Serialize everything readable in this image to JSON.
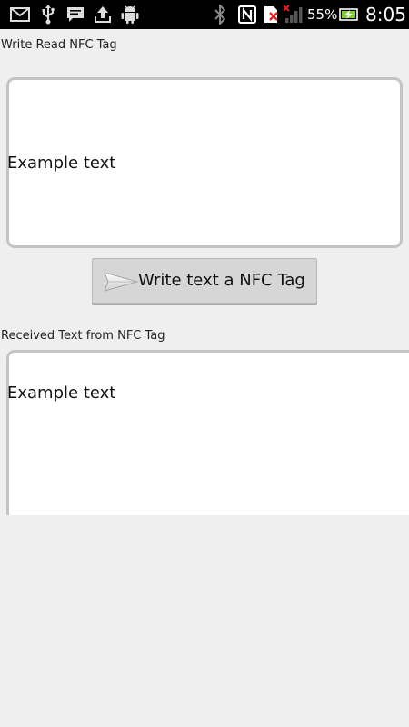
{
  "status_bar": {
    "icons_left": [
      "gmail-icon",
      "usb-icon",
      "sms-icon",
      "upload-icon",
      "android-debug-icon"
    ],
    "icons_right": [
      "bluetooth-icon",
      "nfc-icon",
      "sim-error-icon",
      "signal-icon"
    ],
    "battery_percent": "55%",
    "battery_icon": "battery-charging-icon",
    "time": "8:05"
  },
  "write_section": {
    "label": "Write Read NFC Tag",
    "text_value": "Example text"
  },
  "write_button": {
    "label": "Write text a NFC Tag",
    "icon": "send-icon"
  },
  "received_section": {
    "label": "Received Text from NFC Tag",
    "text_value": "Example text"
  },
  "colors": {
    "background": "#efefef",
    "status_bar": "#000000",
    "button": "#d6d6d6",
    "field_border": "#c4c4c4"
  }
}
